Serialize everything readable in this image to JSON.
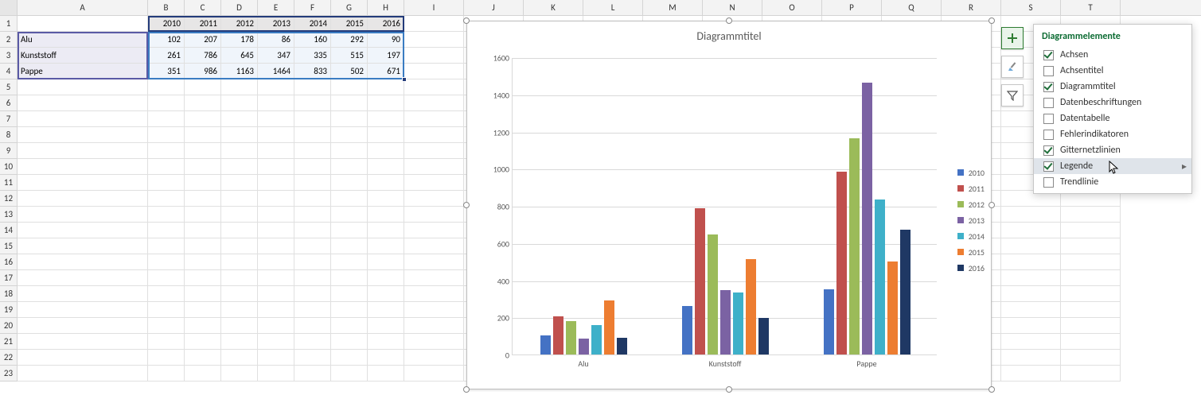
{
  "columns": [
    "A",
    "B",
    "C",
    "D",
    "E",
    "F",
    "G",
    "H",
    "I",
    "J",
    "K",
    "L",
    "M",
    "N",
    "O",
    "P",
    "Q",
    "R",
    "S",
    "T"
  ],
  "row_count": 23,
  "data_table": {
    "row_labels": [
      "Alu",
      "Kunststoff",
      "Pappe"
    ],
    "col_years": [
      "2010",
      "2011",
      "2012",
      "2013",
      "2014",
      "2015",
      "2016"
    ],
    "values": [
      [
        102,
        207,
        178,
        86,
        160,
        292,
        90
      ],
      [
        261,
        786,
        645,
        347,
        335,
        515,
        197
      ],
      [
        351,
        986,
        1163,
        1464,
        833,
        502,
        671
      ]
    ]
  },
  "chart_data": {
    "type": "bar",
    "title": "Diagrammtitel",
    "categories": [
      "Alu",
      "Kunststoff",
      "Pappe"
    ],
    "series": [
      {
        "name": "2010",
        "color": "#4472c4",
        "values": [
          102,
          261,
          351
        ]
      },
      {
        "name": "2011",
        "color": "#c0504d",
        "values": [
          207,
          786,
          986
        ]
      },
      {
        "name": "2012",
        "color": "#9bbb59",
        "values": [
          178,
          645,
          1163
        ]
      },
      {
        "name": "2013",
        "color": "#7b62a3",
        "values": [
          86,
          347,
          1464
        ]
      },
      {
        "name": "2014",
        "color": "#3eb0c9",
        "values": [
          160,
          335,
          833
        ]
      },
      {
        "name": "2015",
        "color": "#ed7d31",
        "values": [
          292,
          515,
          502
        ]
      },
      {
        "name": "2016",
        "color": "#1f3864",
        "values": [
          90,
          197,
          671
        ]
      }
    ],
    "ymax": 1600,
    "ystep": 200,
    "xlabel": "",
    "ylabel": ""
  },
  "flyout": {
    "title": "Diagrammelemente",
    "items": [
      {
        "label": "Achsen",
        "checked": true
      },
      {
        "label": "Achsentitel",
        "checked": false
      },
      {
        "label": "Diagrammtitel",
        "checked": true
      },
      {
        "label": "Datenbeschriftungen",
        "checked": false
      },
      {
        "label": "Datentabelle",
        "checked": false
      },
      {
        "label": "Fehlerindikatoren",
        "checked": false
      },
      {
        "label": "Gitternetzlinien",
        "checked": true
      },
      {
        "label": "Legende",
        "checked": true,
        "hover": true,
        "hasSubmenu": true
      },
      {
        "label": "Trendlinie",
        "checked": false
      }
    ]
  }
}
